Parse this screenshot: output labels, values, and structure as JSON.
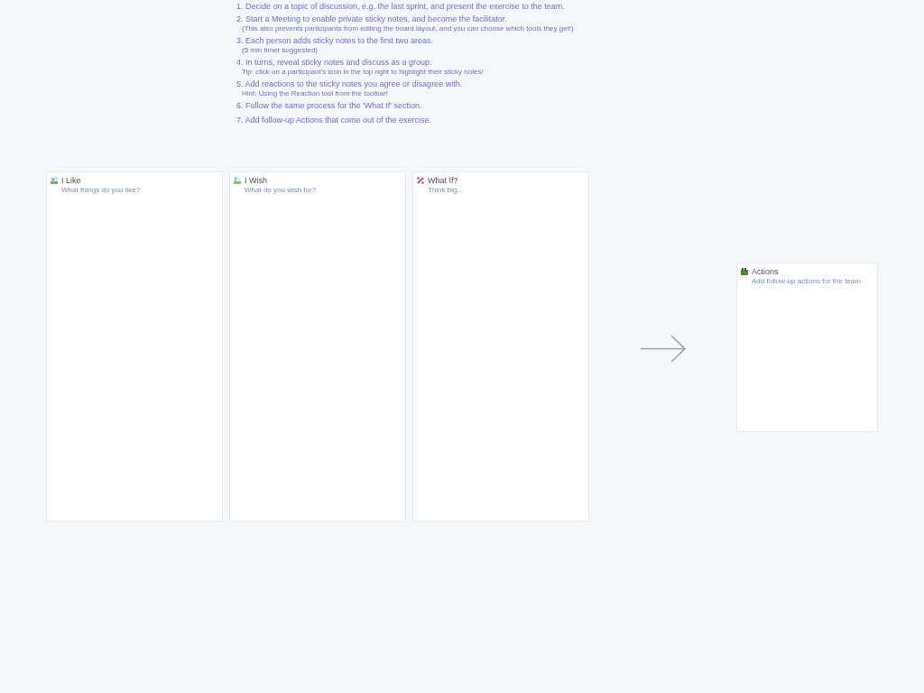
{
  "instructions": [
    {
      "text": "1. Decide on a topic of discussion, e.g. the last sprint, and present the exercise to the team."
    },
    {
      "text": "2. Start a Meeting to enable private sticky notes, and become the facilitator.",
      "note": "(This also prevents participants from editing the board layout, and you can choose which tools they get!)"
    },
    {
      "text": "3. Each person adds sticky notes to the first two areas.",
      "note": "(5 min timer suggested)"
    },
    {
      "text": "4. In turns, reveal sticky notes and discuss as a group.",
      "note": "Tip: click on a participant's icon in the top right to highlight their sticky notes!"
    },
    {
      "text": "5. Add reactions to the sticky notes you agree or disagree with.",
      "note": "Hint: Using the Reaction tool from the toolbar!"
    },
    {
      "text": "6. Follow the same process for the 'What If' section."
    },
    {
      "text": "7. Add follow-up Actions that come out of the exercise."
    }
  ],
  "frames": [
    {
      "kind": "like",
      "title": "I Like",
      "subtitle": "What things do you like?"
    },
    {
      "kind": "wish",
      "title": "I Wish",
      "subtitle": "What do you wish for?"
    },
    {
      "kind": "whatif",
      "title": "What If?",
      "subtitle": "Think big..."
    },
    {
      "kind": "actions",
      "title": "Actions",
      "subtitle": "Add follow-up actions for the team"
    }
  ]
}
